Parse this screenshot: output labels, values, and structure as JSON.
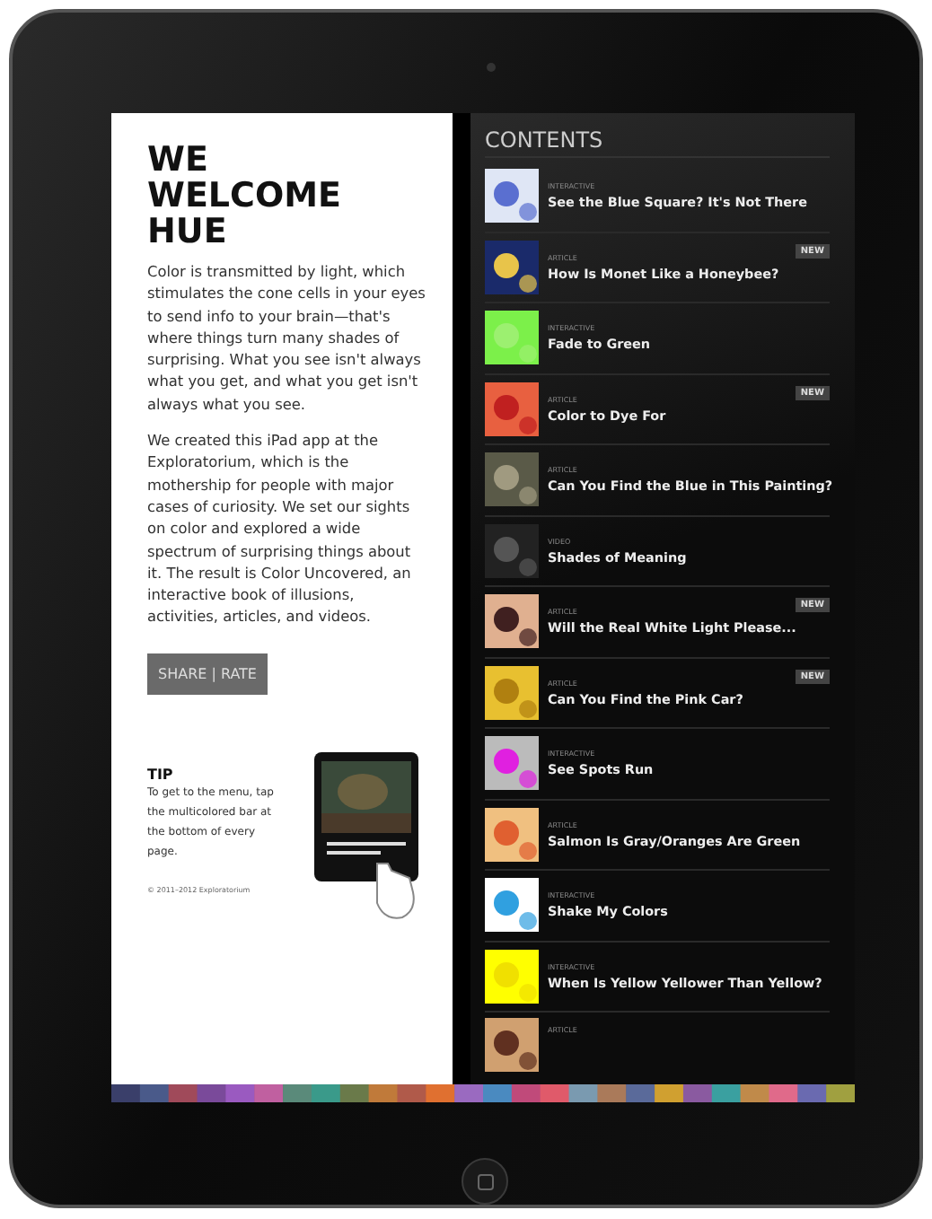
{
  "intro": {
    "title": "WE WELCOME HUE",
    "paragraphs": [
      "Color is transmitted by light, which stimulates the cone cells in your eyes to send info to your brain—that's where things turn many shades of surprising. What you see isn't always what you get, and what you get isn't always what you see.",
      "We created this iPad app at the Exploratorium, which is the mothership for people with major cases of curiosity. We set our sights on color and explored a wide spectrum of surprising things about it. The result is Color Uncovered, an interactive book of illusions, activities, articles, and videos."
    ],
    "button": "SHARE | RATE",
    "tip": {
      "title": "TIP",
      "text": "To get to the menu, tap the multicolored bar at the bottom of every page."
    },
    "copyright": "© 2011–2012 Exploratorium"
  },
  "contents": {
    "title": "CONTENTS",
    "items": [
      {
        "type": "INTERACTIVE",
        "title": "See the Blue Square? It's Not There"
      },
      {
        "type": "ARTICLE",
        "title": "How Is Monet Like a Honeybee?",
        "badge": "NEW"
      },
      {
        "type": "INTERACTIVE",
        "title": "Fade to Green"
      },
      {
        "type": "ARTICLE",
        "title": "Color to Dye For",
        "badge": "NEW"
      },
      {
        "type": "ARTICLE",
        "title": "Can You Find the Blue in This Painting?"
      },
      {
        "type": "VIDEO",
        "title": "Shades of Meaning"
      },
      {
        "type": "ARTICLE",
        "title": "Will the Real White Light Please...",
        "badge": "NEW"
      },
      {
        "type": "ARTICLE",
        "title": "Can You Find the Pink Car?",
        "badge": "NEW"
      },
      {
        "type": "INTERACTIVE",
        "title": "See Spots Run"
      },
      {
        "type": "ARTICLE",
        "title": "Salmon Is Gray/Oranges Are Green"
      },
      {
        "type": "INTERACTIVE",
        "title": "Shake My Colors"
      },
      {
        "type": "INTERACTIVE",
        "title": "When Is Yellow Yellower Than Yellow?"
      },
      {
        "type": "ARTICLE"
      }
    ]
  }
}
